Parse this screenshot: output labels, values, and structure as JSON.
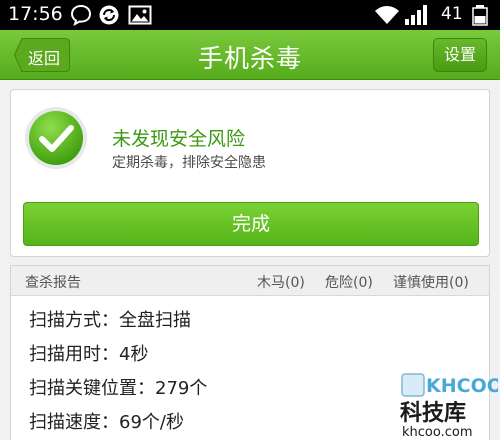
{
  "status_bar": {
    "time": "17:56",
    "battery": "41",
    "icons": [
      "chat-bubble-icon",
      "sync-icon",
      "image-icon",
      "wifi-icon",
      "signal-icon",
      "battery-icon"
    ]
  },
  "header": {
    "back_label": "返回",
    "title": "手机杀毒",
    "settings_label": "设置"
  },
  "result": {
    "title": "未发现安全风险",
    "subtitle": "定期杀毒，排除安全隐患",
    "done_label": "完成"
  },
  "report": {
    "title": "查杀报告",
    "stats": [
      "木马(0)",
      "危险(0)",
      "谨慎使用(0)"
    ],
    "lines": [
      "扫描方式：全盘扫描",
      "扫描用时：4秒",
      "扫描关键位置：279个",
      "扫描速度：69个/秒"
    ]
  },
  "watermark": {
    "logo": "KHCOO",
    "name": "科技库",
    "url": "khcoo.com"
  },
  "colors": {
    "header_green": "#56ac1c",
    "accent_green": "#3a9a10",
    "button_green": "#64bf24"
  }
}
